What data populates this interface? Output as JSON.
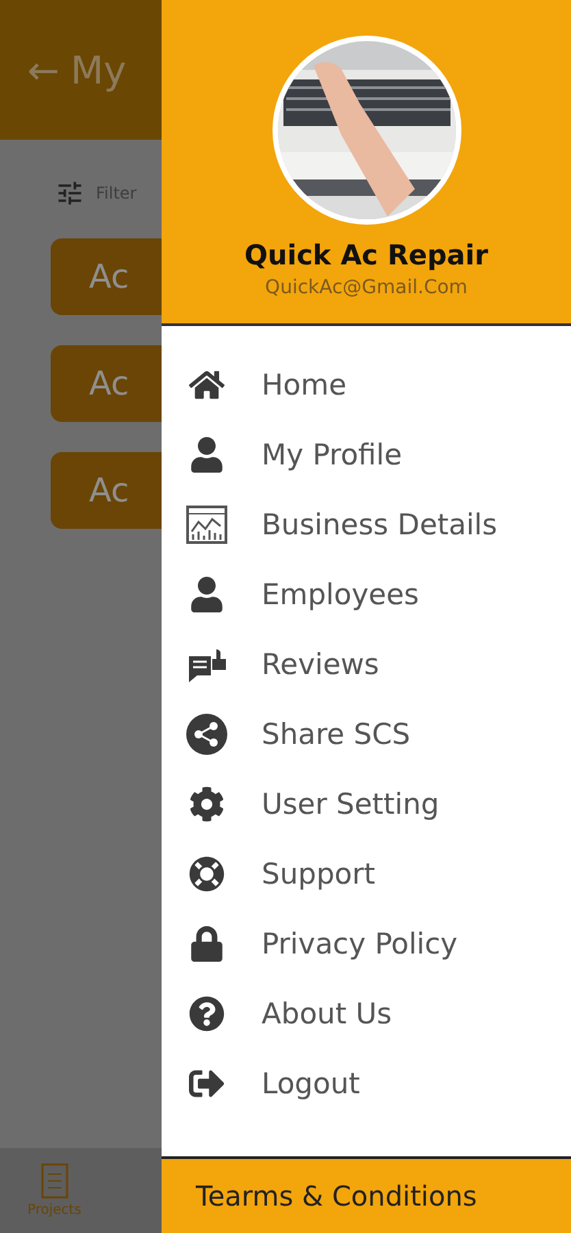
{
  "background_screen": {
    "header": {
      "back": "←",
      "title": "My"
    },
    "filter": {
      "label": "Filter"
    },
    "buttons": [
      "Ac",
      "Ac",
      "Ac"
    ],
    "bottom_nav": [
      {
        "label": "Projects",
        "selected": true
      }
    ]
  },
  "drawer": {
    "profile": {
      "name": "Quick Ac Repair",
      "email": "QuickAc@Gmail.Com"
    },
    "items": [
      {
        "label": "Home"
      },
      {
        "label": "My Profile"
      },
      {
        "label": "Business Details"
      },
      {
        "label": "Employees"
      },
      {
        "label": "Reviews"
      },
      {
        "label": "Share SCS"
      },
      {
        "label": "User Setting"
      },
      {
        "label": "Support"
      },
      {
        "label": "Privacy Policy"
      },
      {
        "label": "About Us"
      },
      {
        "label": "Logout"
      }
    ],
    "footer": "Tearms & Conditions"
  }
}
